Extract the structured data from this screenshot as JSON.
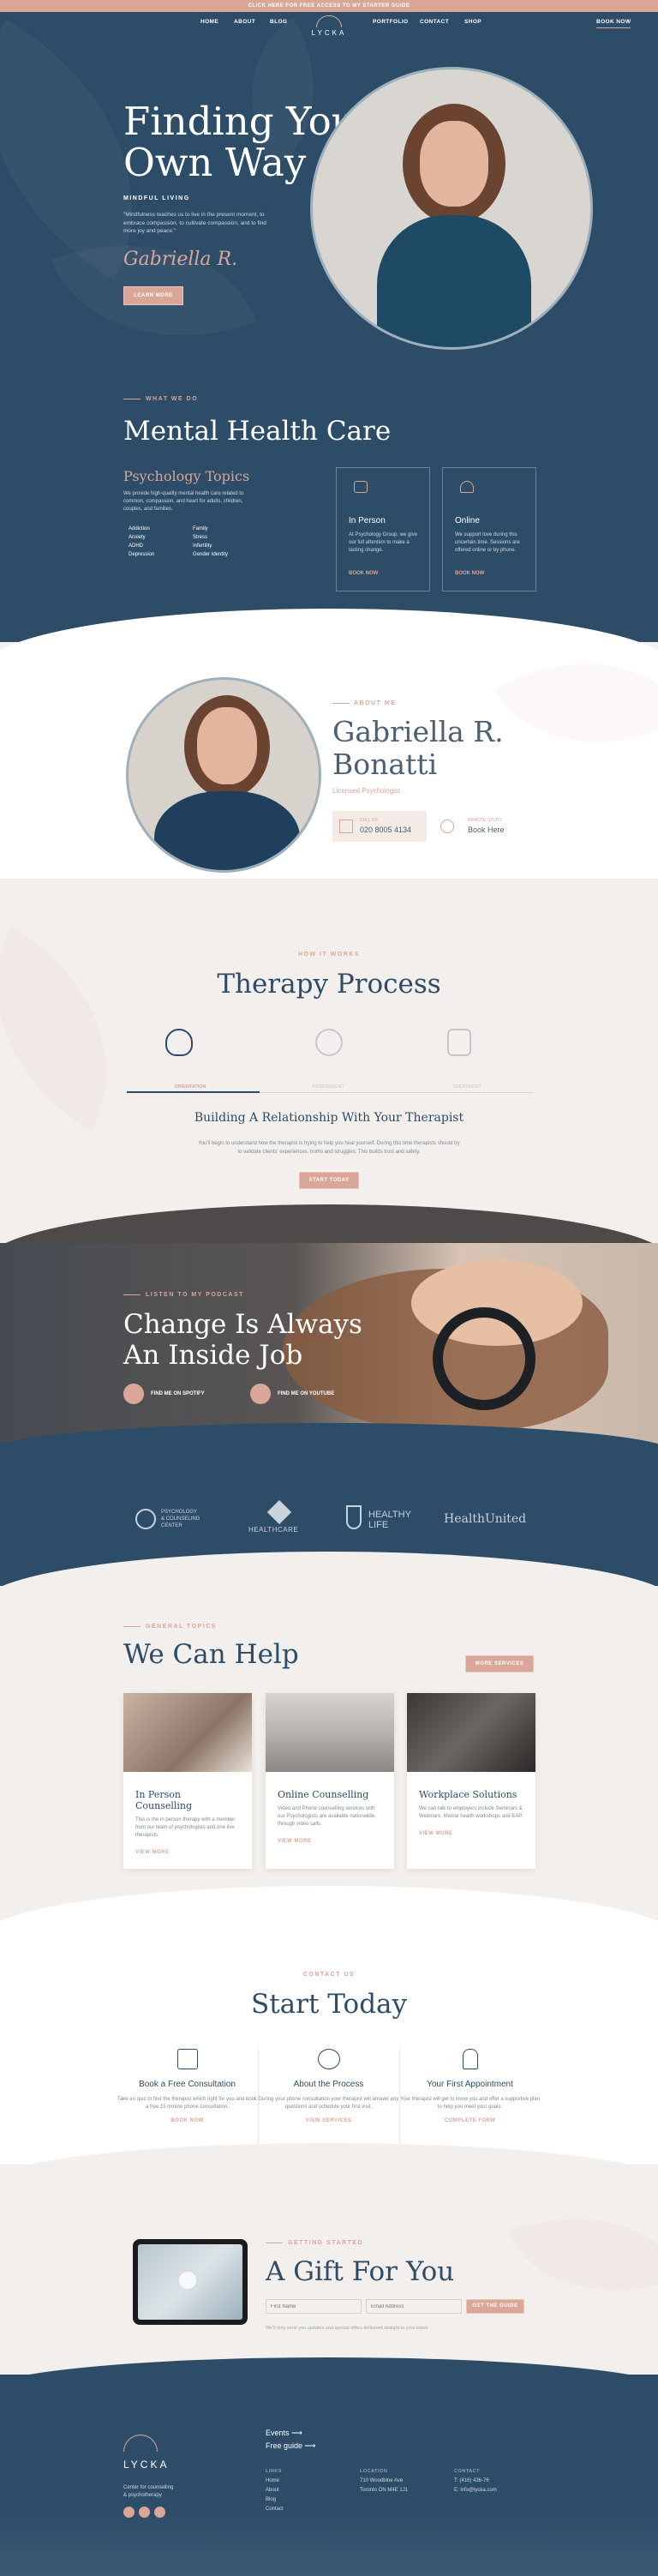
{
  "topbar": {
    "text": "CLICK HERE FOR FREE ACCESS TO MY STARTER GUIDE"
  },
  "nav": {
    "left": [
      "HOME",
      "ABOUT",
      "BLOG"
    ],
    "right": [
      "PORTFOLIO",
      "CONTACT",
      "SHOP"
    ],
    "cta": "BOOK NOW",
    "logo": "LYCKA"
  },
  "hero": {
    "title": "Finding Your Own Way",
    "subtitle": "MINDFUL LIVING",
    "quote": "\"Mindfulness teaches us to live in the present moment, to embrace compassion, to cultivate compassion, and to find more joy and peace.\"",
    "signature": "Gabriella R.",
    "button": "LEARN MORE"
  },
  "mhc": {
    "label": "WHAT WE DO",
    "title": "Mental Health Care",
    "topics_title": "Psychology Topics",
    "topics_text": "We provide high-quality mental health care related to common, compassion, and heart for adults, children, couples, and families.",
    "list_a": [
      "Addiction",
      "Anxiety",
      "ADHD",
      "Depression"
    ],
    "list_b": [
      "Family",
      "Stress",
      "Infertility",
      "Gender Identity"
    ],
    "cards": [
      {
        "title": "In Person",
        "text": "At Psychology Group, we give our full attention to make a lasting change.",
        "more": "BOOK NOW"
      },
      {
        "title": "Online",
        "text": "We support love during this uncertain time. Sessions are offered online or by phone.",
        "more": "BOOK NOW"
      }
    ]
  },
  "about": {
    "label": "ABOUT ME",
    "name": "Gabriella R. Bonatti",
    "role": "Licensed Psychologist",
    "call_label": "CALL US",
    "phone": "020 8005 4134",
    "remote_label": "REMOTE STUDY",
    "remote": "Book Here"
  },
  "therapy": {
    "label": "HOW IT WORKS",
    "title": "Therapy Process",
    "steps": [
      "ORIENTATION",
      "ASSESSMENT",
      "TREATMENT"
    ],
    "subtitle": "Building A Relationship With Your Therapist",
    "text": "You'll begin to understand how the therapist is trying to help you heal yourself. During this time therapists should try to validate clients' experiences, truths and struggles. This builds trust and safety.",
    "button": "START TODAY"
  },
  "podcast": {
    "label": "LISTEN TO MY PODCAST",
    "title": "Change Is Always An Inside Job",
    "spotify": "FIND ME ON SPOTIFY",
    "youtube": "FIND ME ON YOUTUBE"
  },
  "logos": [
    {
      "a": "PSYCHOLOGY",
      "b": "& COUNSELING",
      "c": "CENTER"
    },
    {
      "a": "HEALTHCARE"
    },
    {
      "a": "HEALTHY",
      "b": "LIFE"
    },
    {
      "a": "HealthUnited"
    }
  ],
  "help": {
    "label": "GENERAL TOPICS",
    "title": "We Can Help",
    "button": "MORE SERVICES",
    "cards": [
      {
        "title": "In Person Counselling",
        "text": "This is the in person therapy with a member from our team of psychologists and one live therapists.",
        "more": "VIEW MORE"
      },
      {
        "title": "Online Counselling",
        "text": "Video and Phone counselling services with our Psychologists are available nationwide, through video calls.",
        "more": "VIEW MORE"
      },
      {
        "title": "Workplace Solutions",
        "text": "We can talk to employers include Seminars & Webinars, Mental health workshops and EAP.",
        "more": "VIEW MORE"
      }
    ]
  },
  "start": {
    "label": "CONTACT US",
    "title": "Start Today",
    "cols": [
      {
        "title": "Book a Free Consultation",
        "text": "Take an quiz to find the therapist which right for you and book a free 15 minute phone consultation.",
        "more": "BOOK NOW"
      },
      {
        "title": "About the Process",
        "text": "During your phone consultation your therapist will answer any questions and schedule your first visit.",
        "more": "VIEW SERVICES"
      },
      {
        "title": "Your First Appointment",
        "text": "Your therapist will get to know you and offer a supportive plan to help you meet your goals.",
        "more": "COMPLETE FORM"
      }
    ]
  },
  "gift": {
    "label": "GETTING STARTED",
    "title": "A Gift For You",
    "ph1": "First Name",
    "ph2": "Email Address",
    "button": "GET THE GUIDE",
    "note": "We'll only send you updates and special offers delivered straight to your inbox."
  },
  "footer": {
    "link1": "Events",
    "link2": "Free guide",
    "logo": "LYCKA",
    "tag1": "Center for counselling",
    "tag2": "& psychotherapy",
    "links_t": "LINKS",
    "links": [
      "Home",
      "About",
      "Blog",
      "Contact"
    ],
    "loc_t": "LOCATION",
    "loc1": "710 Woodbine Ave",
    "loc2": "Toronto ON M4E 1J1",
    "contact_t": "CONTACT",
    "c1": "T: (416) 436-76",
    "c2": "E: info@lycka.com"
  },
  "colors": {
    "navy": "#2d4c67",
    "pink": "#d9a698",
    "cream": "#f3efec"
  }
}
